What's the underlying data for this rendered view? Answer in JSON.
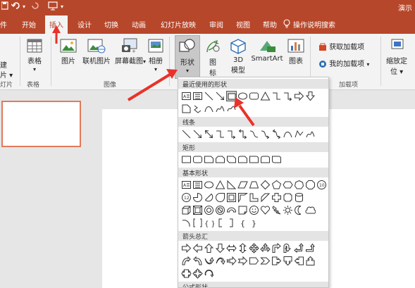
{
  "title_bar": {
    "title_right": "演示"
  },
  "tabs": [
    "件",
    "开始",
    "插入",
    "设计",
    "切换",
    "动画",
    "幻灯片放映",
    "审阅",
    "视图",
    "帮助"
  ],
  "active_tab": "插入",
  "tell_me": "操作说明搜索",
  "ribbon": {
    "left_cut_top": "建",
    "left_cut_mid": "片 ▾",
    "left_cut_group": "灯片",
    "table_label": "表格",
    "table_group": "表格",
    "picture_label": "图片",
    "online_picture_label": "联机图片",
    "screenshot_label": "屏幕截图",
    "album_label": "相册",
    "images_group": "图像",
    "shapes_label": "形状",
    "icons_label_1": "图",
    "icons_label_2": "标",
    "model_label_1": "3D",
    "model_label_2": "模型",
    "smartart_label": "SmartArt",
    "chart_label": "图表",
    "get_addins_label": "获取加载项",
    "my_addins_label": "我的加载项",
    "addins_group": "加载项",
    "zoom_label_1": "缩放定",
    "zoom_label_2": "位 ▾"
  },
  "shapes_menu": {
    "sections": [
      "最近使用的形状",
      "线条",
      "矩形",
      "基本形状",
      "箭头总汇",
      "公式形状"
    ]
  },
  "colors": {
    "accent": "#b7472a",
    "thumb_border": "#e07b5a",
    "annotation": "#e8322a"
  }
}
